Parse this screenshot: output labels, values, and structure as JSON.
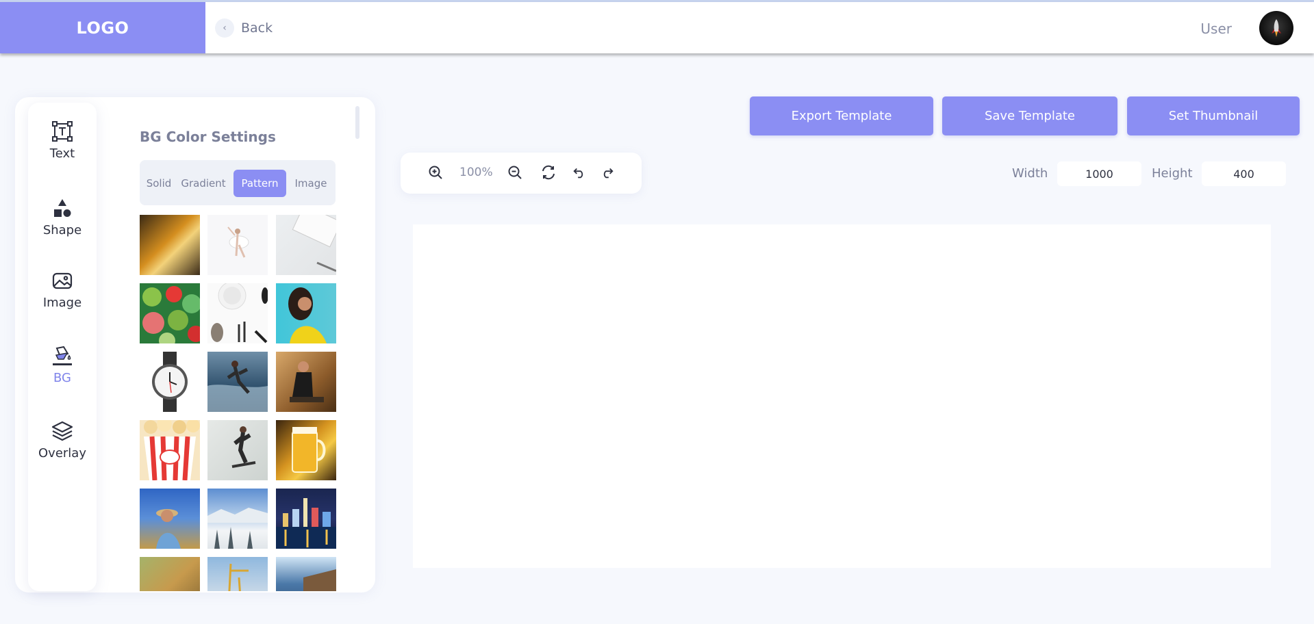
{
  "header": {
    "logo": "LOGO",
    "back_label": "Back",
    "user_label": "User"
  },
  "tools": [
    {
      "label": "Text",
      "icon": "text-frame-icon"
    },
    {
      "label": "Shape",
      "icon": "shapes-icon"
    },
    {
      "label": "Image",
      "icon": "image-icon"
    },
    {
      "label": "BG",
      "icon": "paint-bucket-icon",
      "active": true
    },
    {
      "label": "Overlay",
      "icon": "layers-icon"
    }
  ],
  "settings": {
    "title": "BG Color Settings",
    "tabs": [
      {
        "label": "Solid"
      },
      {
        "label": "Gradient"
      },
      {
        "label": "Pattern",
        "active": true
      },
      {
        "label": "Image"
      }
    ]
  },
  "toolbar": {
    "zoom": "100%"
  },
  "actions": {
    "export": "Export Template",
    "save": "Save Template",
    "thumbnail": "Set Thumbnail"
  },
  "dimensions": {
    "width_label": "Width",
    "width_value": "1000",
    "height_label": "Height",
    "height_value": "400"
  },
  "colors": {
    "accent": "#8b8ef3",
    "background": "#f6f8fd"
  }
}
